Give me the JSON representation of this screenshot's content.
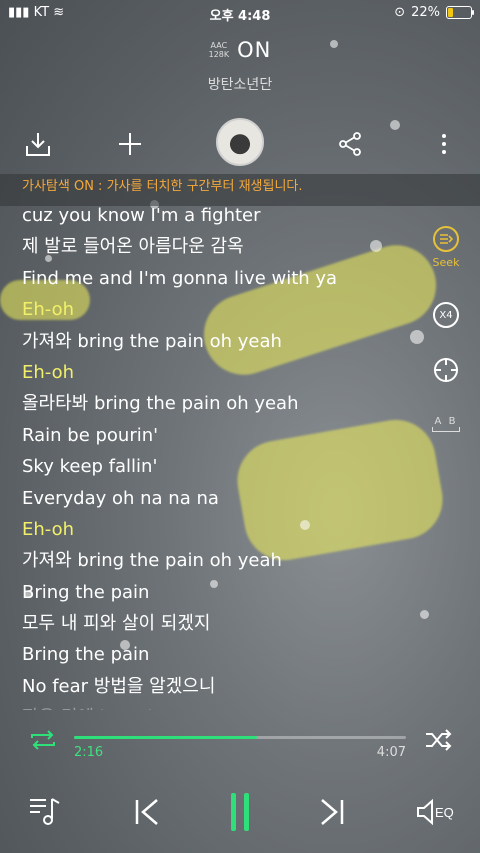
{
  "status": {
    "carrier": "KT",
    "time": "오후 4:48",
    "battery": "22%",
    "battery_level": 0.22
  },
  "player": {
    "quality_line1": "AAC",
    "quality_line2": "128K",
    "title": "ON",
    "artist": "방탄소년단"
  },
  "notice": "가사탐색 ON : 가사를 터치한 구간부터 재생됩니다.",
  "lyrics": [
    "cuz you know I'm a fighter",
    "제 발로 들어온 아름다운 감옥",
    "Find me and I'm gonna live with ya",
    "Eh-oh",
    "가져와 bring the pain oh yeah",
    "Eh-oh",
    "올라타봐 bring the pain oh yeah",
    "Rain be pourin'",
    "Sky keep fallin'",
    "Everyday oh na na na",
    "Eh-oh",
    "가져와 bring the pain oh yeah",
    "Bring the pain",
    "모두 내 피와 살이 되겠지",
    "Bring the pain",
    "No fear 방법을 알겠으니",
    "작은 것에 breathe"
  ],
  "side": {
    "seek_label": "Seek",
    "speed_label": "X4",
    "ab_label": "A B"
  },
  "progress": {
    "elapsed": "2:16",
    "total": "4:07",
    "fraction": 0.55
  },
  "colors": {
    "accent": "#2fe07a",
    "notice": "#f5a93b",
    "seek": "#e7c13a"
  }
}
